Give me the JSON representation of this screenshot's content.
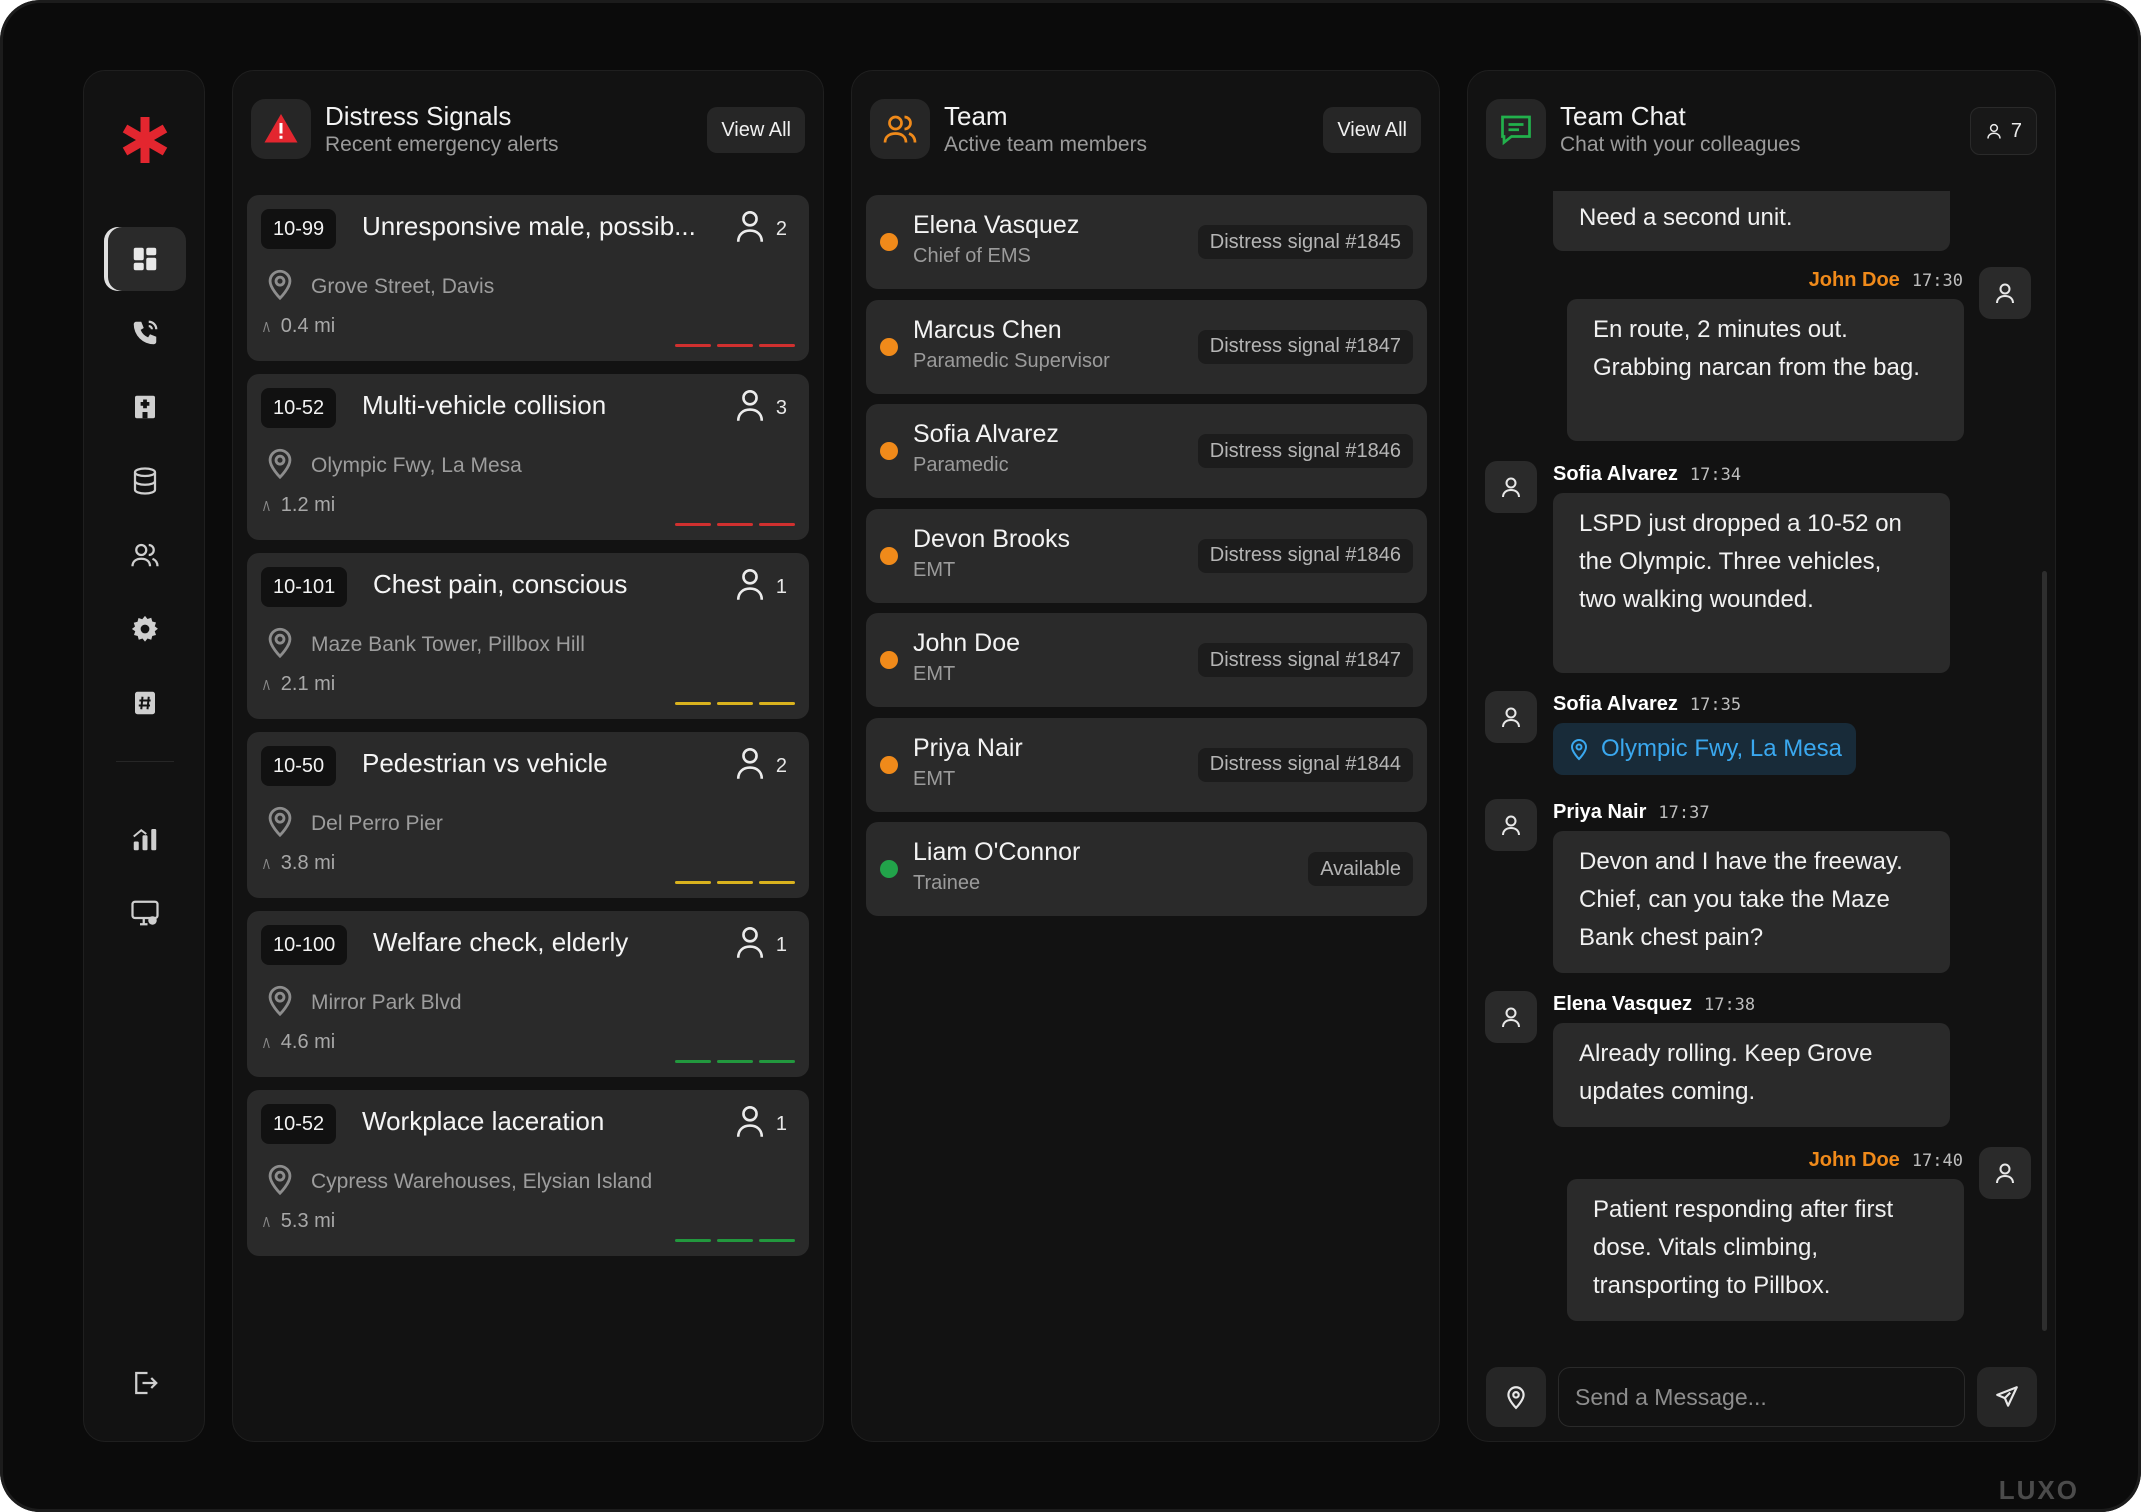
{
  "sidebar": {
    "logo": "asterisk-logo",
    "items": [
      {
        "name": "dashboard",
        "icon": "grid-icon",
        "active": true
      },
      {
        "name": "calls",
        "icon": "phone-icon",
        "active": false
      },
      {
        "name": "hospital",
        "icon": "hospital-icon",
        "active": false
      },
      {
        "name": "database",
        "icon": "database-icon",
        "active": false
      },
      {
        "name": "team",
        "icon": "users-icon",
        "active": false
      },
      {
        "name": "settings",
        "icon": "gear-icon",
        "active": false
      },
      {
        "name": "units",
        "icon": "hash-icon",
        "active": false
      },
      {
        "name": "analytics",
        "icon": "chart-icon",
        "active": false
      },
      {
        "name": "system",
        "icon": "monitor-gear-icon",
        "active": false
      }
    ],
    "logout_icon": "logout-icon"
  },
  "signals": {
    "title": "Distress Signals",
    "subtitle": "Recent emergency alerts",
    "view_all": "View All",
    "cards": [
      {
        "code": "10-99",
        "title": "Unresponsive male, possib...",
        "people": "2",
        "location": "Grove Street, Davis",
        "distance": "0.4 mi",
        "severity": "#d0302f"
      },
      {
        "code": "10-52",
        "title": "Multi-vehicle collision",
        "people": "3",
        "location": "Olympic Fwy, La Mesa",
        "distance": "1.2 mi",
        "severity": "#d0302f"
      },
      {
        "code": "10-101",
        "title": "Chest pain, conscious",
        "people": "1",
        "location": "Maze Bank Tower, Pillbox Hill",
        "distance": "2.1 mi",
        "severity": "#d9b21e"
      },
      {
        "code": "10-50",
        "title": "Pedestrian vs vehicle",
        "people": "2",
        "location": "Del Perro Pier",
        "distance": "3.8 mi",
        "severity": "#d9b21e"
      },
      {
        "code": "10-100",
        "title": "Welfare check, elderly",
        "people": "1",
        "location": "Mirror Park Blvd",
        "distance": "4.6 mi",
        "severity": "#22983e"
      },
      {
        "code": "10-52",
        "title": "Workplace laceration",
        "people": "1",
        "location": "Cypress Warehouses, Elysian Island",
        "distance": "5.3 mi",
        "severity": "#22983e"
      }
    ]
  },
  "team": {
    "title": "Team",
    "subtitle": "Active team members",
    "view_all": "View All",
    "members": [
      {
        "name": "Elena Vasquez",
        "role": "Chief of EMS",
        "status": "Distress signal #1845",
        "dot": "#f08a1a"
      },
      {
        "name": "Marcus Chen",
        "role": "Paramedic Supervisor",
        "status": "Distress signal #1847",
        "dot": "#f08a1a"
      },
      {
        "name": "Sofia Alvarez",
        "role": "Paramedic",
        "status": "Distress signal #1846",
        "dot": "#f08a1a"
      },
      {
        "name": "Devon Brooks",
        "role": "EMT",
        "status": "Distress signal #1846",
        "dot": "#f08a1a"
      },
      {
        "name": "John Doe",
        "role": "EMT",
        "status": "Distress signal #1847",
        "dot": "#f08a1a"
      },
      {
        "name": "Priya Nair",
        "role": "EMT",
        "status": "Distress signal #1844",
        "dot": "#f08a1a"
      },
      {
        "name": "Liam O'Connor",
        "role": "Trainee",
        "status": "Available",
        "dot": "#22a34a"
      }
    ]
  },
  "chat": {
    "title": "Team Chat",
    "subtitle": "Chat with your colleagues",
    "online_count": "7",
    "messages": [
      {
        "text": "Need a second unit."
      },
      {
        "author": "John Doe",
        "time": "17:30",
        "text": "En route, 2 minutes out. Grabbing narcan from the bag."
      },
      {
        "author": "Sofia Alvarez",
        "time": "17:34",
        "text": "LSPD just dropped a 10-52 on the Olympic. Three vehicles, two walking wounded."
      },
      {
        "author": "Sofia Alvarez",
        "time": "17:35",
        "location": "Olympic Fwy, La Mesa"
      },
      {
        "author": "Priya Nair",
        "time": "17:37",
        "text": "Devon and I have the freeway. Chief, can you take the Maze Bank chest pain?"
      },
      {
        "author": "Elena Vasquez",
        "time": "17:38",
        "text": "Already rolling. Keep Grove updates coming."
      },
      {
        "author": "John Doe",
        "time": "17:40",
        "text": "Patient responding after first dose. Vitals climbing, transporting to Pillbox."
      }
    ],
    "input_placeholder": "Send a Message...",
    "accent_me": "#f08a1a",
    "accent_location": "#3aa8ef"
  },
  "brand": "LUXO"
}
